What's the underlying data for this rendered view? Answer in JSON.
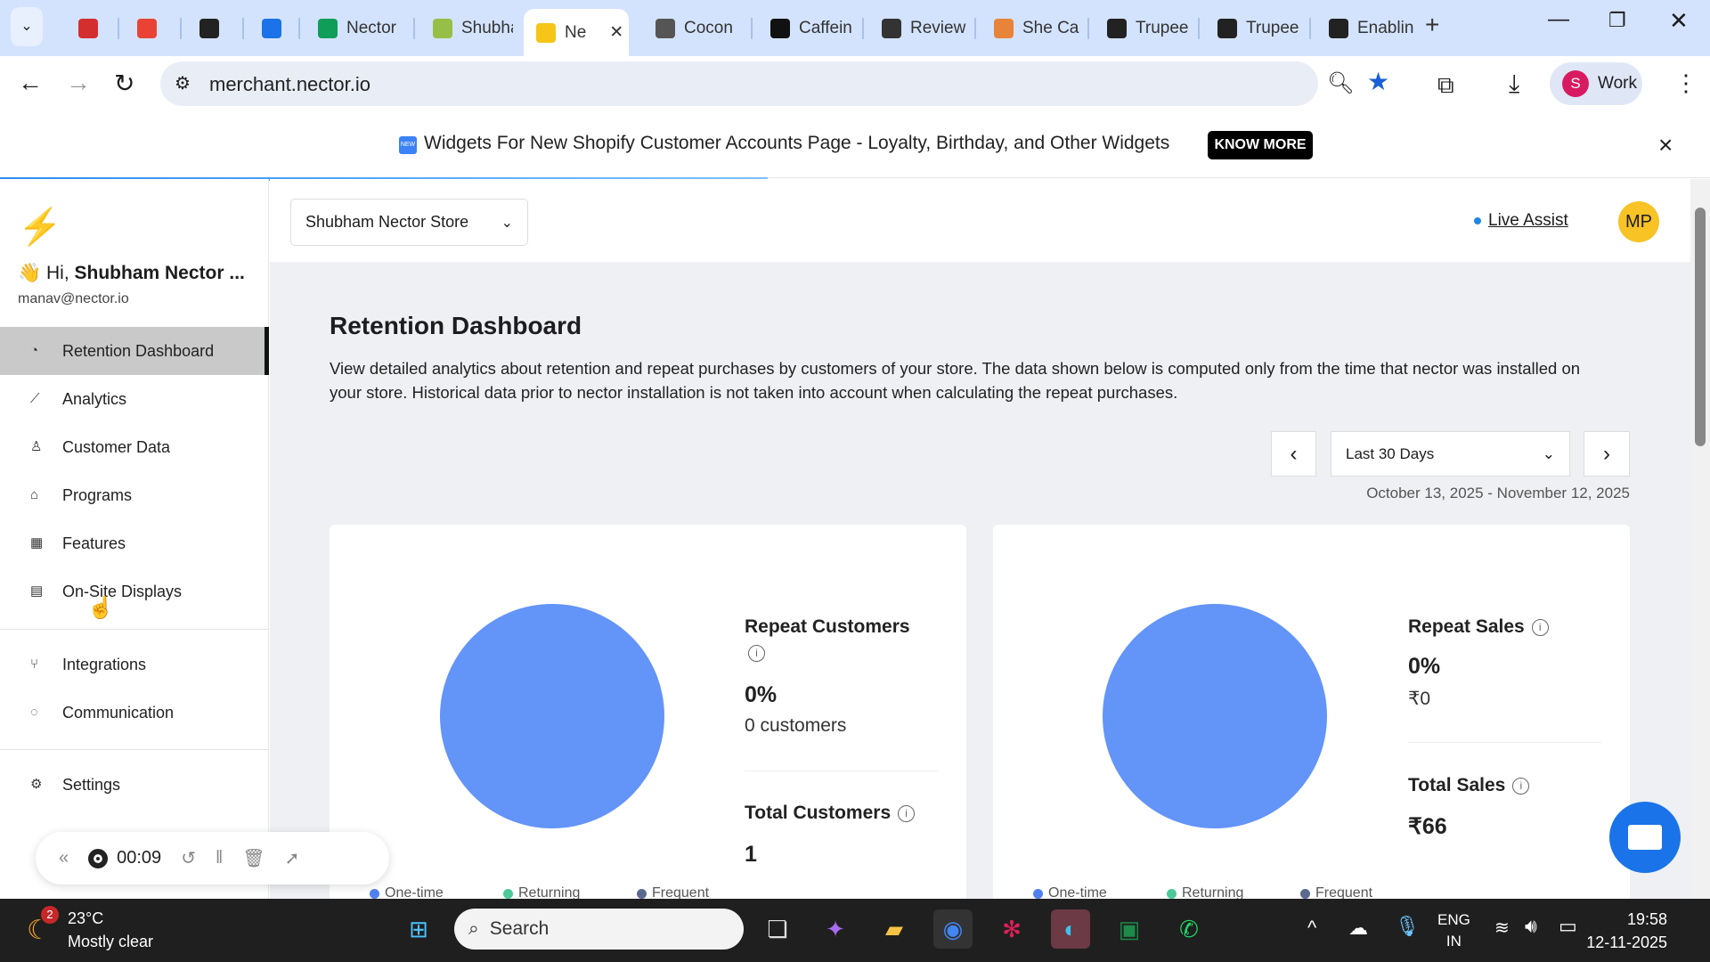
{
  "browser": {
    "tabs": [
      {
        "label": "",
        "icon": "record-icon",
        "color": "#d32f2f",
        "pinned": true
      },
      {
        "label": "",
        "icon": "gmail-icon",
        "color": "#ea4335",
        "pinned": true
      },
      {
        "label": "",
        "icon": "chatgpt-icon",
        "color": "#222",
        "pinned": true
      },
      {
        "label": "",
        "icon": "calendar-icon",
        "color": "#1a73e8",
        "pinned": true
      },
      {
        "label": "Nector",
        "icon": "sheets-icon",
        "color": "#0f9d58"
      },
      {
        "label": "Shubha",
        "icon": "shopify-icon",
        "color": "#95bf47"
      },
      {
        "label": "Ne",
        "icon": "nector-bolt-icon",
        "color": "#f5c518",
        "active": true
      },
      {
        "label": "Cocon",
        "icon": "globe-icon",
        "color": "#555"
      },
      {
        "label": "Caffein",
        "icon": "caffeine-icon",
        "color": "#111"
      },
      {
        "label": "Review",
        "icon": "review-icon",
        "color": "#333"
      },
      {
        "label": "She Ca",
        "icon": "flame-icon",
        "color": "#e8833a"
      },
      {
        "label": "Trupee",
        "icon": "trupee-icon",
        "color": "#222"
      },
      {
        "label": "Trupee",
        "icon": "trupee-icon",
        "color": "#222"
      },
      {
        "label": "Enablin",
        "icon": "trupee-icon",
        "color": "#222"
      }
    ],
    "url": "merchant.nector.io",
    "profile_initial": "S",
    "profile_label": "Work"
  },
  "banner": {
    "badge": "NEW",
    "text": "Widgets For New Shopify Customer Accounts Page - Loyalty, Birthday, and Other Widgets",
    "button": "KNOW MORE",
    "close": "×"
  },
  "sidebar": {
    "greeting_prefix": "Hi, ",
    "user_name": "Shubham Nector ...",
    "email": "manav@nector.io",
    "items": [
      {
        "label": "Retention Dashboard",
        "icon": "◔",
        "active": true
      },
      {
        "label": "Analytics",
        "icon": "⟋"
      },
      {
        "label": "Customer Data",
        "icon": "♙"
      },
      {
        "label": "Programs",
        "icon": "⌂"
      },
      {
        "label": "Features",
        "icon": "▦"
      },
      {
        "label": "On-Site Displays",
        "icon": "▤"
      },
      {
        "label": "Integrations",
        "icon": "⑂"
      },
      {
        "label": "Communication",
        "icon": "◌"
      },
      {
        "label": "Settings",
        "icon": "⚙"
      }
    ]
  },
  "header": {
    "store": "Shubham Nector Store",
    "live_assist": "Live Assist",
    "avatar": "MP"
  },
  "main": {
    "title": "Retention Dashboard",
    "description": "View detailed analytics about retention and repeat purchases by customers of your store. The data shown below is computed only from the time that nector was installed on your store. Historical data prior to nector installation is not taken into account when calculating the repeat purchases.",
    "period": "Last 30 Days",
    "date_range": "October 13, 2025 - November 12, 2025",
    "customers_card": {
      "repeat_label": "Repeat Customers",
      "repeat_pct": "0%",
      "repeat_count": "0 customers",
      "total_label": "Total Customers",
      "total_value": "1"
    },
    "sales_card": {
      "repeat_label": "Repeat Sales",
      "repeat_pct": "0%",
      "repeat_amount": "₹0",
      "total_label": "Total Sales",
      "total_value": "₹66"
    },
    "legend": [
      {
        "label": "One-time",
        "color": "#4f7ff0"
      },
      {
        "label": "Returning",
        "color": "#4cc99a"
      },
      {
        "label": "Frequent",
        "color": "#5a6a8f"
      }
    ]
  },
  "recorder": {
    "time": "00:09"
  },
  "taskbar": {
    "weather_temp": "23°C",
    "weather_desc": "Mostly clear",
    "weather_badge": "2",
    "search": "Search",
    "lang1": "ENG",
    "lang2": "IN",
    "time": "19:58",
    "date": "12-11-2025"
  }
}
